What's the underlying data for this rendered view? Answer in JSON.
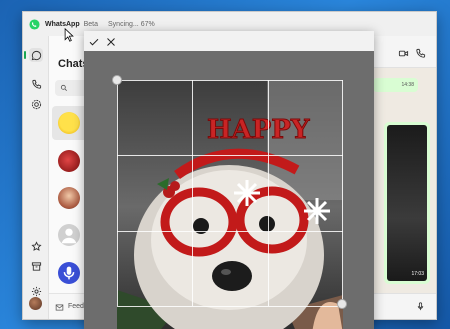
{
  "titlebar": {
    "app_name": "WhatsApp",
    "beta": "Beta",
    "sync_status": "Syncing... 67%"
  },
  "rail": {
    "items": [
      {
        "name": "chats",
        "icon": "chat-icon",
        "active": true
      },
      {
        "name": "calls",
        "icon": "phone-icon",
        "active": false
      },
      {
        "name": "status",
        "icon": "status-icon",
        "active": false
      },
      {
        "name": "starred",
        "icon": "star-icon",
        "active": false
      },
      {
        "name": "archived",
        "icon": "archive-icon",
        "active": false
      },
      {
        "name": "settings",
        "icon": "gear-icon",
        "active": false
      }
    ]
  },
  "chats": {
    "title": "Chats",
    "search_placeholder": "S",
    "rows": [
      {
        "avatar": "smiley-avatar",
        "selected": true
      },
      {
        "avatar": "red-avatar",
        "selected": false
      },
      {
        "avatar": "photo-avatar",
        "selected": false
      },
      {
        "avatar": "default-avatar",
        "selected": false
      },
      {
        "avatar": "audio-avatar",
        "selected": false
      }
    ]
  },
  "footer": {
    "feed_label": "Feed"
  },
  "conversation": {
    "message_time_1": "14:38",
    "image_time": "17:03"
  },
  "crop": {
    "confirm_icon": "check-icon",
    "cancel_icon": "close-icon",
    "image_subject": "dog wearing Happy New Year glasses"
  },
  "colors": {
    "accent": "#1aa552",
    "bubble": "#d9fdd3",
    "wallpaper": "#efeae2",
    "overlay": "#6d6d6d"
  }
}
